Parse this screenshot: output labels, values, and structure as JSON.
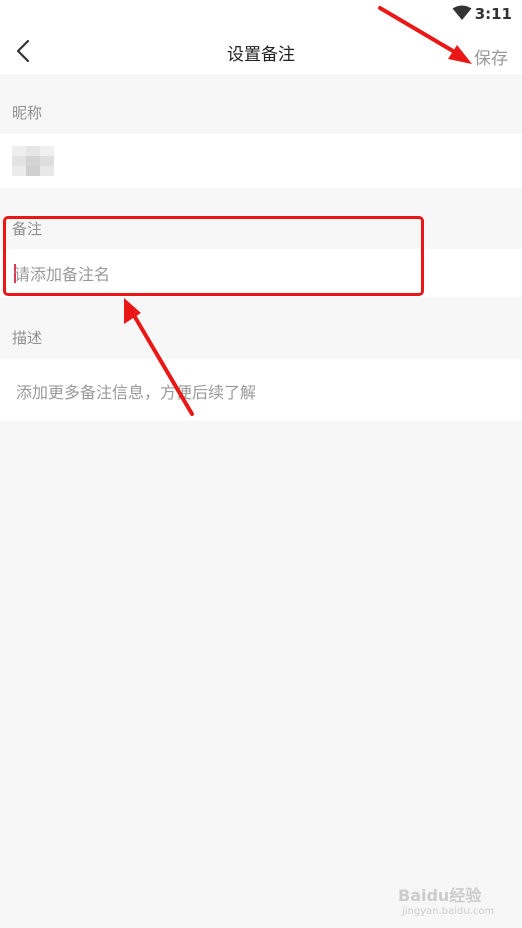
{
  "status_bar": {
    "time": "3:11",
    "wifi_icon": "wifi-icon"
  },
  "header": {
    "title": "设置备注",
    "save_label": "保存",
    "back_icon": "chevron-left-icon"
  },
  "nickname": {
    "label": "昵称",
    "avatar": "blurred-avatar"
  },
  "remark": {
    "label": "备注",
    "value": "",
    "placeholder": "请添加备注名"
  },
  "description": {
    "label": "描述",
    "placeholder": "添加更多备注信息，方便后续了解"
  },
  "watermark": {
    "text": "Baidu经验",
    "sub": "jingyan.baidu.com"
  },
  "annotation": {
    "color": "#ea1717"
  }
}
